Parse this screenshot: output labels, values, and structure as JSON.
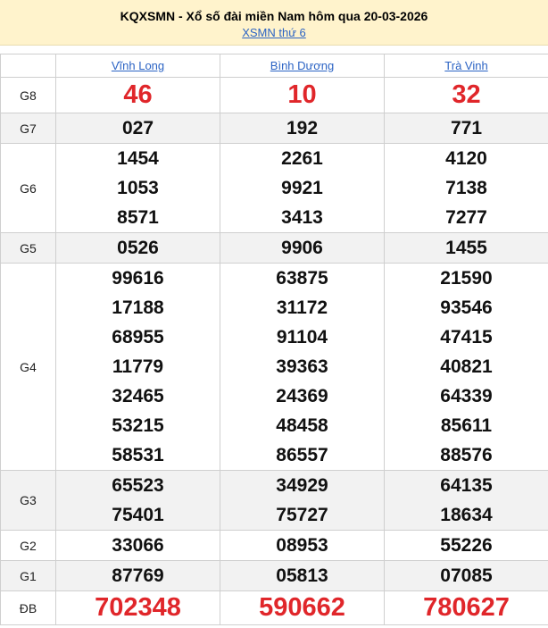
{
  "header": {
    "title": "KQXSMN - Xổ số đài miền Nam hôm qua 20-03-2026",
    "subtitle_link": "XSMN thứ 6"
  },
  "provinces": [
    "Vĩnh Long",
    "Bình Dương",
    "Trà Vinh"
  ],
  "prizes": [
    {
      "label": "G8",
      "values": [
        [
          "46"
        ],
        [
          "10"
        ],
        [
          "32"
        ]
      ]
    },
    {
      "label": "G7",
      "values": [
        [
          "027"
        ],
        [
          "192"
        ],
        [
          "771"
        ]
      ]
    },
    {
      "label": "G6",
      "values": [
        [
          "1454",
          "1053",
          "8571"
        ],
        [
          "2261",
          "9921",
          "3413"
        ],
        [
          "4120",
          "7138",
          "7277"
        ]
      ]
    },
    {
      "label": "G5",
      "values": [
        [
          "0526"
        ],
        [
          "9906"
        ],
        [
          "1455"
        ]
      ]
    },
    {
      "label": "G4",
      "values": [
        [
          "99616",
          "17188",
          "68955",
          "11779",
          "32465",
          "53215",
          "58531"
        ],
        [
          "63875",
          "31172",
          "91104",
          "39363",
          "24369",
          "48458",
          "86557"
        ],
        [
          "21590",
          "93546",
          "47415",
          "40821",
          "64339",
          "85611",
          "88576"
        ]
      ]
    },
    {
      "label": "G3",
      "values": [
        [
          "65523",
          "75401"
        ],
        [
          "34929",
          "75727"
        ],
        [
          "64135",
          "18634"
        ]
      ]
    },
    {
      "label": "G2",
      "values": [
        [
          "33066"
        ],
        [
          "08953"
        ],
        [
          "55226"
        ]
      ]
    },
    {
      "label": "G1",
      "values": [
        [
          "87769"
        ],
        [
          "05813"
        ],
        [
          "07085"
        ]
      ]
    },
    {
      "label": "ĐB",
      "values": [
        [
          "702348"
        ],
        [
          "590662"
        ],
        [
          "780627"
        ]
      ]
    }
  ],
  "colors": {
    "header_bg": "#fff3cc",
    "link": "#2b63c4",
    "highlight_red": "#e0262a",
    "stripe": "#f2f2f2"
  }
}
